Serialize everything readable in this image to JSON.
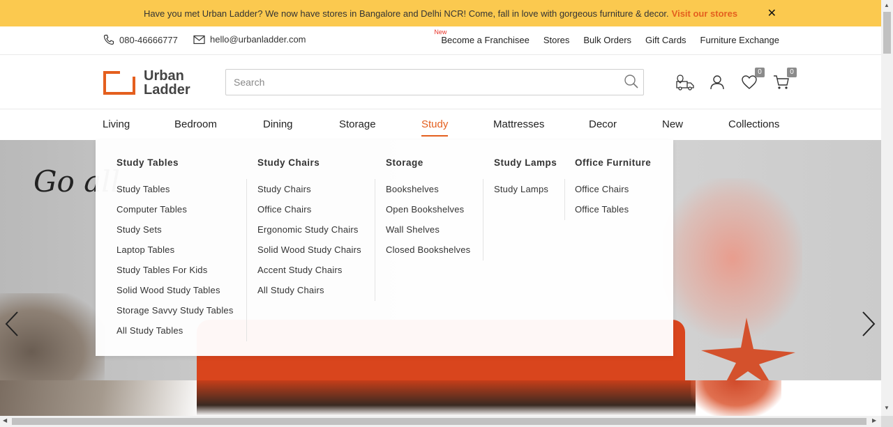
{
  "announcement": {
    "text": "Have you met Urban Ladder? We now have stores in Bangalore and Delhi NCR! Come, fall in love with gorgeous furniture & decor.",
    "link": "Visit our stores",
    "close": "✕"
  },
  "utility": {
    "phone": "080-46666777",
    "email": "hello@urbanladder.com",
    "new_tag": "New",
    "links": [
      "Become a Franchisee",
      "Stores",
      "Bulk Orders",
      "Gift Cards",
      "Furniture Exchange"
    ]
  },
  "header": {
    "logo_line1": "Urban",
    "logo_line2": "Ladder",
    "search_placeholder": "Search",
    "wishlist_count": "0",
    "cart_count": "0"
  },
  "nav": {
    "items": [
      "Living",
      "Bedroom",
      "Dining",
      "Storage",
      "Study",
      "Mattresses",
      "Decor",
      "New",
      "Collections"
    ],
    "active": "Study"
  },
  "hero": {
    "script_text": "Go all"
  },
  "dropdown": {
    "columns": [
      {
        "title": "Study Tables",
        "items": [
          "Study Tables",
          "Computer Tables",
          "Study Sets",
          "Laptop Tables",
          "Study Tables For Kids",
          "Solid Wood Study Tables",
          "Storage Savvy Study Tables",
          "All Study Tables"
        ]
      },
      {
        "title": "Study Chairs",
        "items": [
          "Study Chairs",
          "Office Chairs",
          "Ergonomic Study Chairs",
          "Solid Wood Study Chairs",
          "Accent Study Chairs",
          "All Study Chairs"
        ]
      },
      {
        "title": "Storage",
        "items": [
          "Bookshelves",
          "Open Bookshelves",
          "Wall Shelves",
          "Closed Bookshelves"
        ]
      },
      {
        "title": "Study Lamps",
        "items": [
          "Study Lamps"
        ]
      },
      {
        "title": "Office Furniture",
        "items": [
          "Office Chairs",
          "Office Tables"
        ]
      }
    ]
  },
  "colors": {
    "accent": "#e45f1e",
    "announce_bg": "#fbc94f",
    "badge": "#8b8b8b"
  },
  "icons": [
    "phone-icon",
    "mail-icon",
    "search-icon",
    "delivery-truck-icon",
    "user-icon",
    "heart-icon",
    "cart-icon",
    "chevron-left-icon",
    "chevron-right-icon",
    "close-icon"
  ]
}
